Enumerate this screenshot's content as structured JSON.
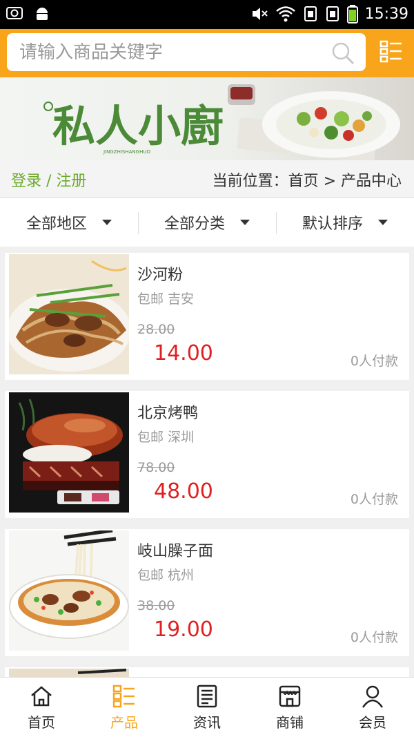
{
  "status_bar": {
    "time": "15:39"
  },
  "search": {
    "placeholder": "请输入商品关键字"
  },
  "breadcrumb": {
    "login_label": "登录 / 注册",
    "location_label": "当前位置：首页 > 产品中心"
  },
  "filters": [
    {
      "label": "全部地区"
    },
    {
      "label": "全部分类"
    },
    {
      "label": "默认排序"
    }
  ],
  "products": [
    {
      "name": "沙河粉",
      "meta": "包邮 吉安",
      "old_price": "28.00",
      "price": "14.00",
      "paid": "0人付款"
    },
    {
      "name": "北京烤鸭",
      "meta": "包邮 深圳",
      "old_price": "78.00",
      "price": "48.00",
      "paid": "0人付款"
    },
    {
      "name": "岐山臊子面",
      "meta": "包邮 杭州",
      "old_price": "38.00",
      "price": "19.00",
      "paid": "0人付款"
    }
  ],
  "tabbar": [
    {
      "label": "首页",
      "icon": "home-icon"
    },
    {
      "label": "产品",
      "icon": "grid-list-icon",
      "active": true
    },
    {
      "label": "资讯",
      "icon": "news-icon"
    },
    {
      "label": "商铺",
      "icon": "shop-icon"
    },
    {
      "label": "会员",
      "icon": "user-icon"
    }
  ],
  "colors": {
    "accent": "#f9a51b",
    "price": "#e02020",
    "login": "#6aaa2a"
  }
}
